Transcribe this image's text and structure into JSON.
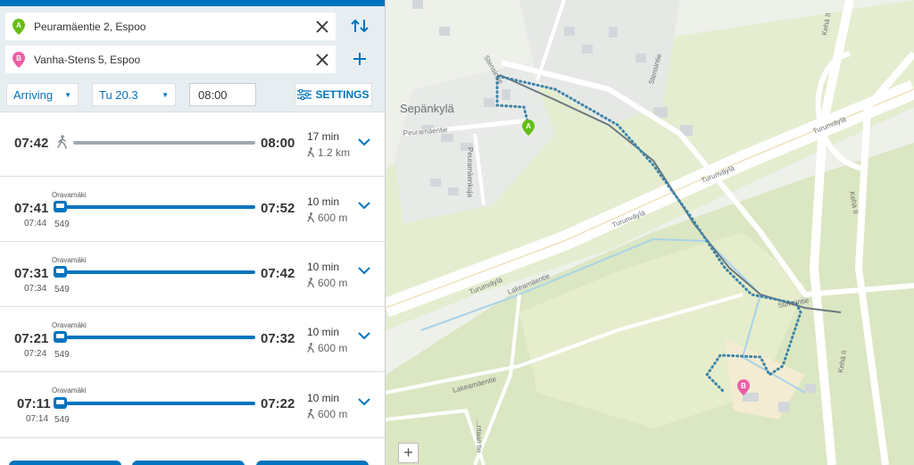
{
  "search": {
    "origin": "Peuramäentie 2, Espoo",
    "destination": "Vanha-Stens 5, Espoo",
    "origin_marker": "A",
    "destination_marker": "B"
  },
  "controls": {
    "mode": "Arriving",
    "date": "Tu 20.3",
    "time": "08:00",
    "settings_label": "SETTINGS"
  },
  "itineraries": [
    {
      "type": "walk",
      "departure": "07:42",
      "arrival": "08:00",
      "duration": "17 min",
      "walk_distance": "1.2 km"
    },
    {
      "type": "bus",
      "departure": "07:41",
      "scheduled": "07:44",
      "stop": "Oravamäki",
      "route": "549",
      "arrival": "07:52",
      "duration": "10 min",
      "walk_distance": "600 m"
    },
    {
      "type": "bus",
      "departure": "07:31",
      "scheduled": "07:34",
      "stop": "Oravamäki",
      "route": "549",
      "arrival": "07:42",
      "duration": "10 min",
      "walk_distance": "600 m"
    },
    {
      "type": "bus",
      "departure": "07:21",
      "scheduled": "07:24",
      "stop": "Oravamäki",
      "route": "549",
      "arrival": "07:32",
      "duration": "10 min",
      "walk_distance": "600 m"
    },
    {
      "type": "bus",
      "departure": "07:11",
      "scheduled": "07:14",
      "stop": "Oravamäki",
      "route": "549",
      "arrival": "07:22",
      "duration": "10 min",
      "walk_distance": "600 m"
    }
  ],
  "map": {
    "area_label": "Sepänkylä",
    "streets": {
      "peuramaentie": "Peuramäentie",
      "peuramaenkuja": "Peuramäenkuja",
      "stensintie_north": "Stensintie",
      "stensintie_mid": "Stensintie",
      "stensintie_east": "Stensintie",
      "turunvayla_1": "Turunväylä",
      "turunvayla_2": "Turunväylä",
      "turunvayla_3": "Turunväylä",
      "turunvayla_4": "Turunväylä",
      "lakeamaentie_1": "Lakeamäentie",
      "lakeamaentie_2": "Lakeamäentie",
      "keha_1": "Kehä II",
      "keha_2": "Kehä II",
      "keha_3": "Kehä II",
      "sw_road": "...ntaan tie"
    },
    "zoom_in_label": "+",
    "colors": {
      "accent": "#0074bf",
      "origin_pin": "#64be14",
      "destination_pin": "#ec5fa6",
      "water": "#a8d3ea",
      "green": "#dfe8c0"
    }
  }
}
